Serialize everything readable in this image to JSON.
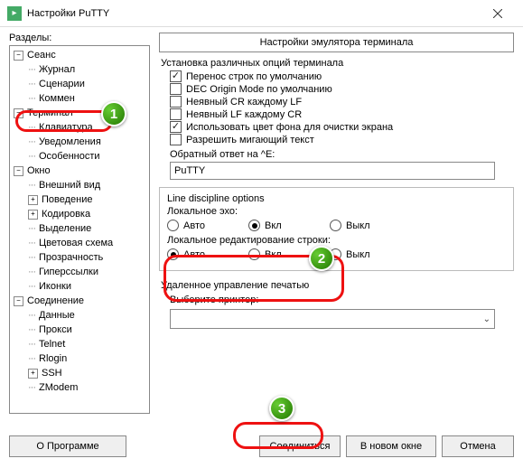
{
  "title": "Настройки PuTTY",
  "categories_label": "Разделы:",
  "tree": [
    {
      "label": "Сеанс",
      "depth": 0,
      "toggle": "-"
    },
    {
      "label": "Журнал",
      "depth": 1
    },
    {
      "label": "Сценарии",
      "depth": 1
    },
    {
      "label": "Коммен",
      "depth": 1
    },
    {
      "label": "Терминал",
      "depth": 0,
      "toggle": "-",
      "hl": true
    },
    {
      "label": "Клавиатура",
      "depth": 1
    },
    {
      "label": "Уведомления",
      "depth": 1
    },
    {
      "label": "Особенности",
      "depth": 1
    },
    {
      "label": "Окно",
      "depth": 0,
      "toggle": "-"
    },
    {
      "label": "Внешний вид",
      "depth": 1
    },
    {
      "label": "Поведение",
      "depth": 1,
      "toggle": "+"
    },
    {
      "label": "Кодировка",
      "depth": 1,
      "toggle": "+"
    },
    {
      "label": "Выделение",
      "depth": 1
    },
    {
      "label": "Цветовая схема",
      "depth": 1
    },
    {
      "label": "Прозрачность",
      "depth": 1
    },
    {
      "label": "Гиперссылки",
      "depth": 1
    },
    {
      "label": "Иконки",
      "depth": 1
    },
    {
      "label": "Соединение",
      "depth": 0,
      "toggle": "-"
    },
    {
      "label": "Данные",
      "depth": 1
    },
    {
      "label": "Прокси",
      "depth": 1
    },
    {
      "label": "Telnet",
      "depth": 1
    },
    {
      "label": "Rlogin",
      "depth": 1
    },
    {
      "label": "SSH",
      "depth": 1,
      "toggle": "+"
    },
    {
      "label": "ZModem",
      "depth": 1
    }
  ],
  "panel": {
    "header": "Настройки эмулятора терминала",
    "section1_title": "Установка различных опций терминала",
    "checks": [
      {
        "label": "Перенос строк по умолчанию",
        "on": true
      },
      {
        "label": "DEC Origin Mode по умолчанию",
        "on": false
      },
      {
        "label": "Неявный CR каждому LF",
        "on": false
      },
      {
        "label": "Неявный LF каждому CR",
        "on": false
      },
      {
        "label": "Использовать цвет фона для очистки экрана",
        "on": true
      },
      {
        "label": "Разрешить мигающий текст",
        "on": false
      }
    ],
    "answerback_label": "Обратный ответ на ^E:",
    "answerback_value": "PuTTY",
    "line_discipline_title": "Line discipline options",
    "echo_label": "Локальное эхо:",
    "edit_label": "Локальное редактирование строки:",
    "radio_auto": "Авто",
    "radio_on": "Вкл",
    "radio_off": "Выкл",
    "printer_section": "Удаленное управление печатью",
    "printer_label": "Выберите принтер:"
  },
  "buttons": {
    "about": "О Программе",
    "connect": "Соединиться",
    "newwin": "В новом окне",
    "cancel": "Отмена"
  },
  "markers": {
    "m1": "1",
    "m2": "2",
    "m3": "3"
  }
}
